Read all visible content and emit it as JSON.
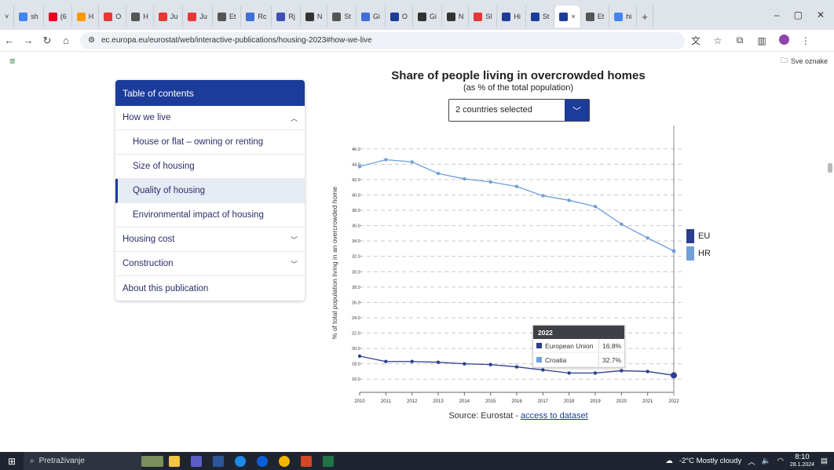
{
  "browser": {
    "tabs": [
      {
        "label": "sh",
        "color": "#4285f4"
      },
      {
        "label": "(6",
        "color": "#e60023"
      },
      {
        "label": "H",
        "color": "#ff9800"
      },
      {
        "label": "O",
        "color": "#e53935"
      },
      {
        "label": "H",
        "color": "#555555"
      },
      {
        "label": "Ju",
        "color": "#e53935"
      },
      {
        "label": "Ju",
        "color": "#e53935"
      },
      {
        "label": "Et",
        "color": "#555555"
      },
      {
        "label": "Rc",
        "color": "#3f6fd8"
      },
      {
        "label": "Rj",
        "color": "#3f51b5"
      },
      {
        "label": "N",
        "color": "#333333"
      },
      {
        "label": "St",
        "color": "#555555"
      },
      {
        "label": "Gi",
        "color": "#3f6fd8"
      },
      {
        "label": "O",
        "color": "#1c3c9a"
      },
      {
        "label": "Gi",
        "color": "#333333"
      },
      {
        "label": "N",
        "color": "#333333"
      },
      {
        "label": "Sl",
        "color": "#e53935"
      },
      {
        "label": "Hi",
        "color": "#1c3c9a"
      },
      {
        "label": "St",
        "color": "#1c3c9a"
      },
      {
        "label": "×",
        "color": "#1c3c9a"
      },
      {
        "label": "Et",
        "color": "#555555"
      },
      {
        "label": "hi",
        "color": "#4285f4"
      }
    ],
    "new_tab": "+",
    "url": "ec.europa.eu/eurostat/web/interactive-publications/housing-2023#how-we-live",
    "bookmarks_label": "Sve oznake"
  },
  "toc": {
    "header": "Table of contents",
    "items": [
      {
        "label": "How we live",
        "chevron": "︿"
      },
      {
        "label": "House or flat – owning or renting"
      },
      {
        "label": "Size of housing"
      },
      {
        "label": "Quality of housing"
      },
      {
        "label": "Environmental impact of housing"
      },
      {
        "label": "Housing cost",
        "chevron": "﹀"
      },
      {
        "label": "Construction",
        "chevron": "﹀"
      },
      {
        "label": "About this publication"
      }
    ]
  },
  "chart_header": {
    "title": "Share of people living in overcrowded homes",
    "subtitle": "(as % of the total population)",
    "select_value": "2 countries selected"
  },
  "chart_data": {
    "type": "line",
    "title": "Share of people living in overcrowded homes",
    "subtitle": "(as % of the total population)",
    "ylabel": "% of total population living in an overcrowded home",
    "x": [
      "2010",
      "2011",
      "2012",
      "2013",
      "2014",
      "2015",
      "2016",
      "2017",
      "2018",
      "2019",
      "2020",
      "2021",
      "2022"
    ],
    "ylim": [
      15,
      47
    ],
    "yticks": [
      "16.0",
      "18.0",
      "20.0",
      "22.0",
      "24.0",
      "26.0",
      "28.0",
      "30.0",
      "32.0",
      "34.0",
      "36.0",
      "38.0",
      "40.0",
      "42.0",
      "44.0",
      "46.0"
    ],
    "grid": true,
    "legend_position": "right",
    "series": [
      {
        "name": "EU",
        "color": "#2b3f8f",
        "values": [
          19.0,
          18.3,
          18.3,
          18.2,
          18.0,
          17.9,
          17.6,
          17.2,
          16.8,
          16.8,
          17.1,
          17.0,
          16.5
        ]
      },
      {
        "name": "HR",
        "color": "#6fa0d8",
        "values": [
          43.7,
          44.6,
          44.3,
          42.8,
          42.1,
          41.7,
          41.1,
          39.9,
          39.3,
          38.5,
          36.2,
          34.4,
          32.7
        ]
      }
    ]
  },
  "tooltip": {
    "year": "2022",
    "rows": [
      {
        "name": "European Union",
        "value": "16.8%",
        "color": "#2b3f8f"
      },
      {
        "name": "Croatia",
        "value": "32.7%",
        "color": "#6fa0d8"
      }
    ]
  },
  "source": {
    "prefix": "Source: Eurostat - ",
    "link": "access to dataset"
  },
  "taskbar": {
    "search_label": "Pretraživanje",
    "weather": "-2°C  Mostly cloudy",
    "time": "8:10",
    "date": "28.1.2024"
  }
}
